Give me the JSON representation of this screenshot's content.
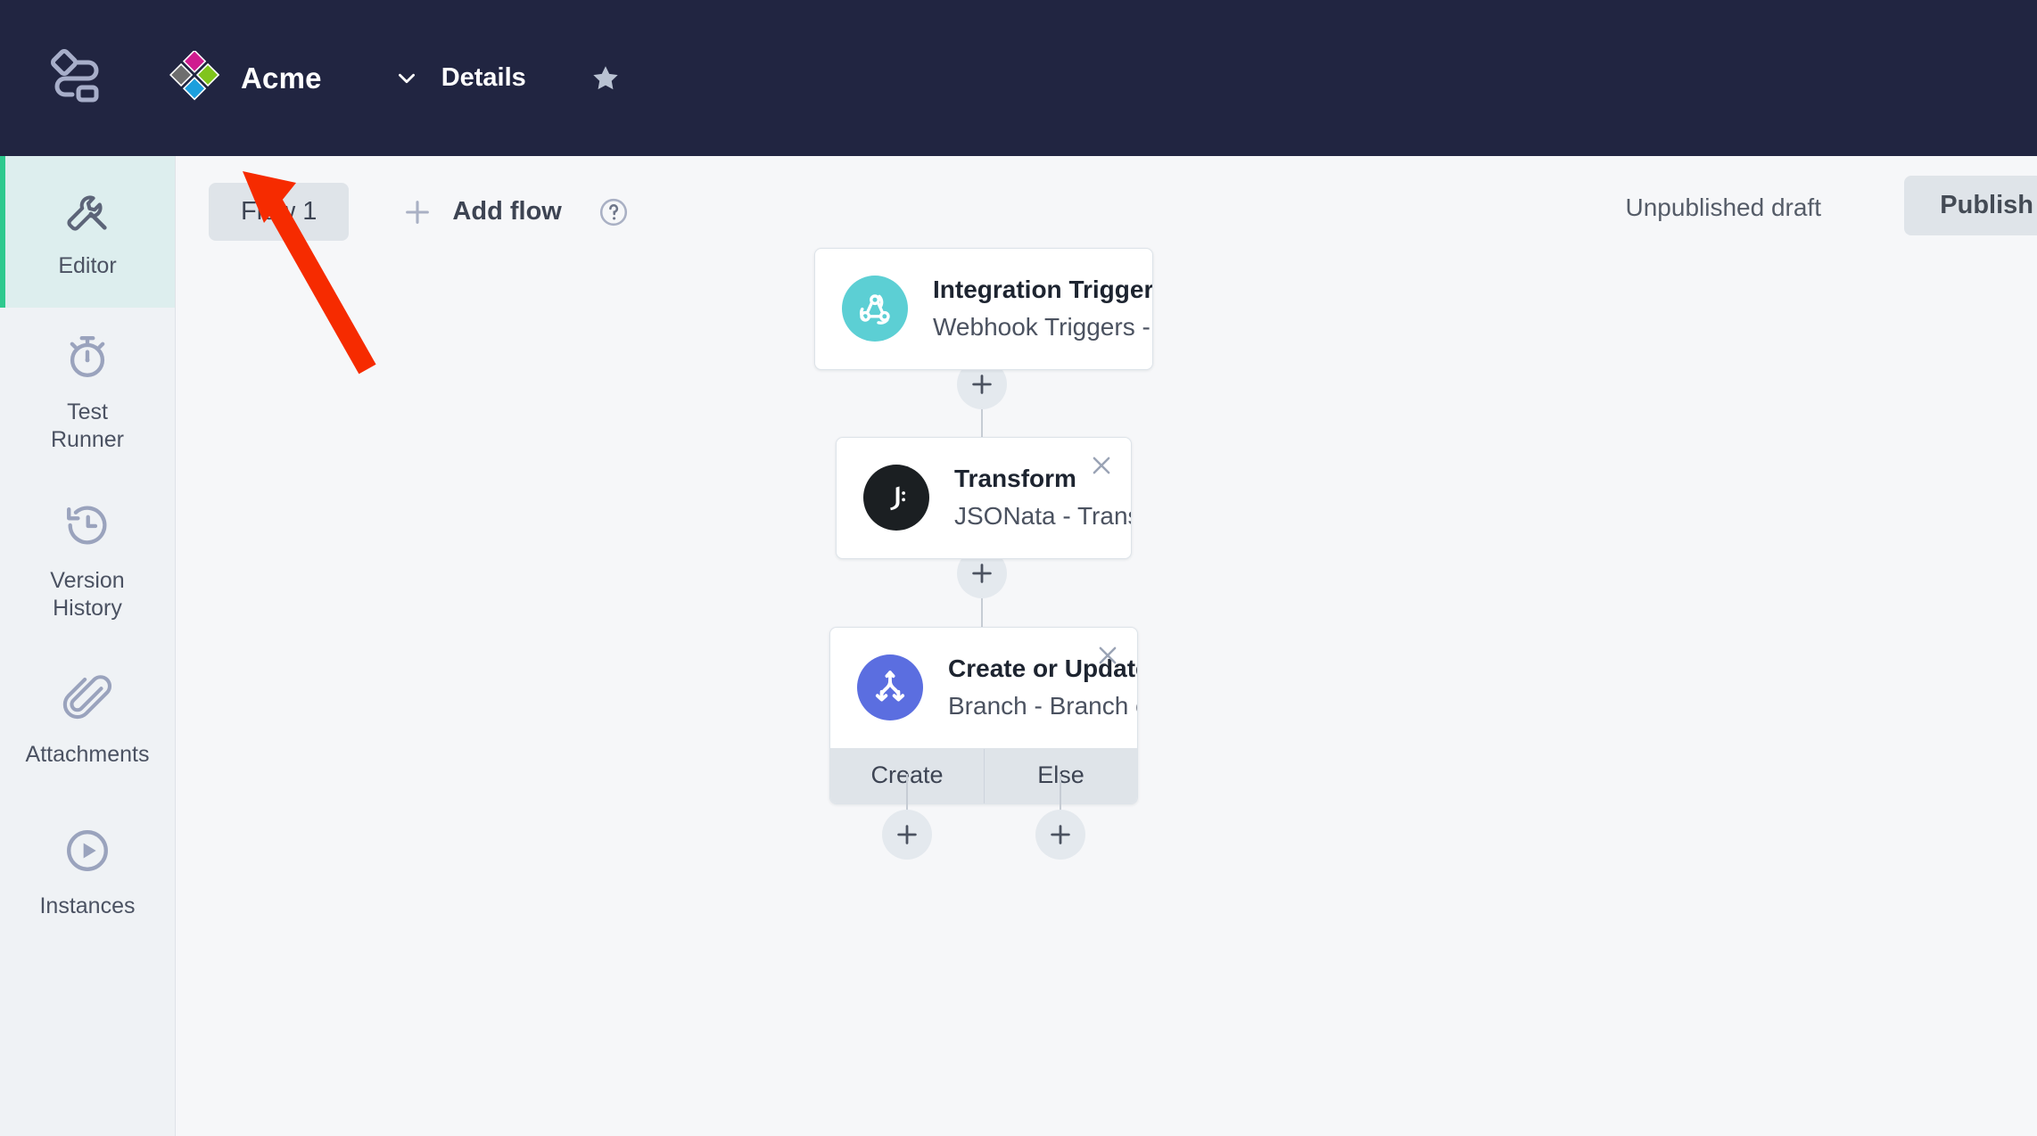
{
  "topbar": {
    "app_icon": "flow-workspace-icon",
    "brand_icon": "acme-diamond-logo",
    "brand_name": "Acme",
    "details_label": "Details",
    "details_chevron_icon": "chevron-down-icon",
    "favorite_icon": "star-icon",
    "background_color": "#212541"
  },
  "sidebar": {
    "items": [
      {
        "label": "Editor",
        "icon": "wrench-icon",
        "active": true
      },
      {
        "label": "Test\nRunner",
        "icon": "stopwatch-icon",
        "active": false
      },
      {
        "label": "Version\nHistory",
        "icon": "history-clock-icon",
        "active": false
      },
      {
        "label": "Attachments",
        "icon": "paperclip-icon",
        "active": false
      },
      {
        "label": "Instances",
        "icon": "play-circle-icon",
        "active": false
      }
    ],
    "active_accent_color": "#2ec98e",
    "active_background_color": "#ddeeee"
  },
  "toolbar": {
    "flow_tab_label": "Flow 1",
    "add_flow_label": "Add flow",
    "add_flow_icon": "plus-icon",
    "help_icon": "question-mark-circle-icon",
    "publish_status": "Unpublished draft",
    "publish_button_label": "Publish"
  },
  "canvas": {
    "nodes": [
      {
        "id": "integration-trigger",
        "title": "Integration Trigger",
        "subtitle": "Webhook Triggers - Webhook",
        "icon": "webhook-icon",
        "icon_color": "#5ccfd4",
        "closable": false,
        "footer": []
      },
      {
        "id": "transform",
        "title": "Transform",
        "subtitle": "JSONata - Transform",
        "icon": "jsonata-icon",
        "icon_color": "#1b1f22",
        "closable": true,
        "close_icon": "close-icon",
        "footer": []
      },
      {
        "id": "create-or-update",
        "title": "Create or Update?",
        "subtitle": "Branch - Branch on Value",
        "icon": "branch-icon",
        "icon_color": "#5b6ee0",
        "closable": true,
        "close_icon": "close-icon",
        "footer": [
          "Create",
          "Else"
        ]
      }
    ],
    "add_step_icon": "plus-icon",
    "connector_color": "#c6ccd4",
    "background_color": "#f6f7f9"
  },
  "annotation": {
    "type": "arrow",
    "color": "#f62b00",
    "points_to": "flow-tab-1"
  }
}
